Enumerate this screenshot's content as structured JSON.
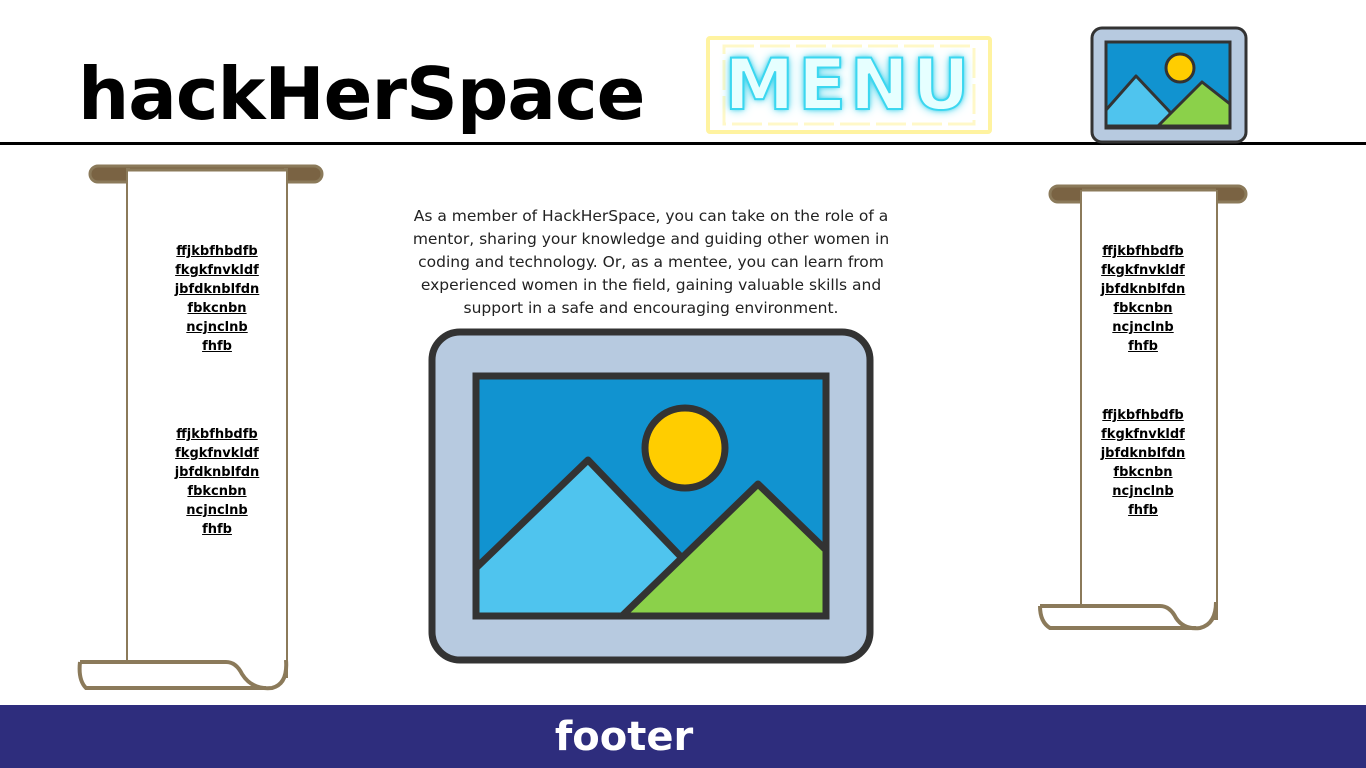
{
  "header": {
    "title": "hackHerSpace",
    "menu_label": "MENU",
    "image_icon": "image-placeholder-icon"
  },
  "left_scroll": {
    "groups": [
      {
        "links": [
          "ffjkbfhbdfb",
          "fkgkfnvkldf",
          "jbfdknblfdn",
          "fbkcnbn",
          "ncjnclnb",
          "fhfb"
        ]
      },
      {
        "links": [
          "ffjkbfhbdfb",
          "fkgkfnvkldf",
          "jbfdknblfdn",
          "fbkcnbn",
          "ncjnclnb",
          "fhfb"
        ]
      }
    ]
  },
  "right_scroll": {
    "groups": [
      {
        "links": [
          "ffjkbfhbdfb",
          "fkgkfnvkldf",
          "jbfdknblfdn",
          "fbkcnbn",
          "ncjnclnb",
          "fhfb"
        ]
      },
      {
        "links": [
          "ffjkbfhbdfb",
          "fkgkfnvkldf",
          "jbfdknblfdn",
          "fbkcnbn",
          "ncjnclnb",
          "fhfb"
        ]
      }
    ]
  },
  "main": {
    "intro": "As a member of HackHerSpace, you can take on the role of a mentor, sharing your knowledge and guiding other women in coding and technology. Or, as a mentee, you can learn from experienced women in the field, gaining valuable skills and support in a safe and encouraging environment.",
    "image_icon": "image-placeholder-icon"
  },
  "footer": {
    "label": "footer"
  },
  "colors": {
    "footer_bg": "#2e2d7d",
    "neon_cyan": "#3bd7f0",
    "neon_yellow": "#fff8b0",
    "scroll_border": "#8b7a5a",
    "scroll_rod": "#6b5535"
  }
}
